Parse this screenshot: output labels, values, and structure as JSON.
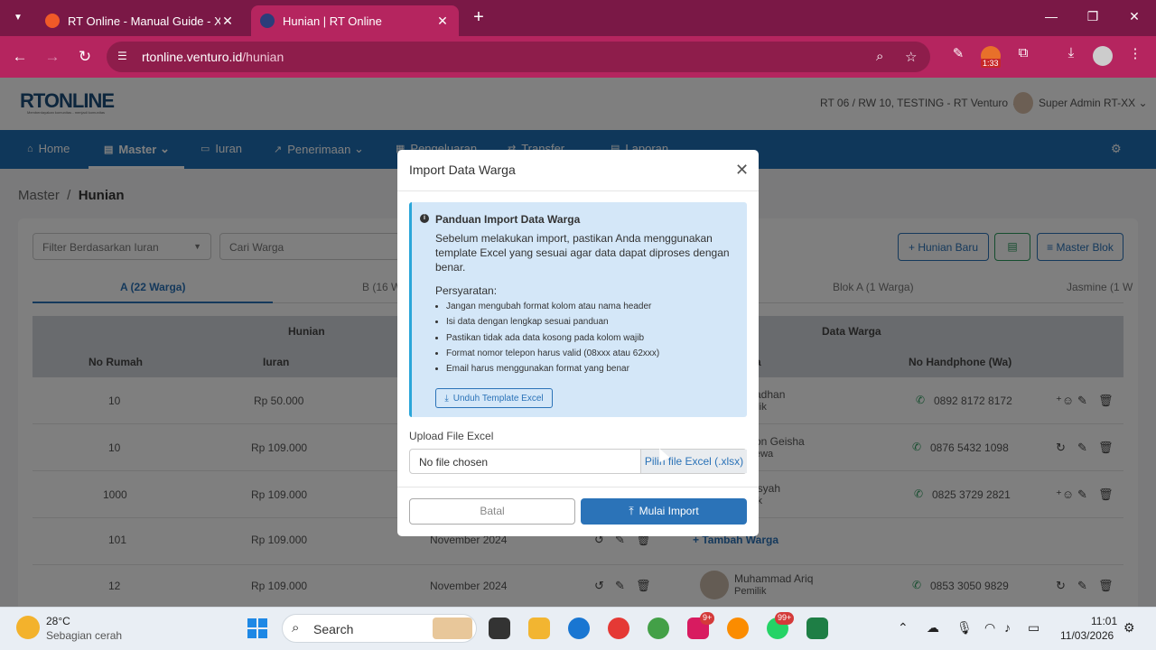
{
  "browser": {
    "tabs": [
      {
        "title": "RT Online - Manual Guide - Xm",
        "active": false
      },
      {
        "title": "Hunian | RT Online",
        "active": true
      }
    ],
    "url_host": "rtonline.venturo.id",
    "url_path": "/hunian",
    "ext_badge": "1:33"
  },
  "app": {
    "logo": "RTONLINE",
    "logo_sub": "Memberdayakan komunitas - menjadi komunitas",
    "rt_selector": "RT 06 / RW 10, TESTING - RT Venturo",
    "user_name": "Super Admin RT-XX",
    "nav": [
      {
        "label": "Home"
      },
      {
        "label": "Master"
      },
      {
        "label": "Iuran"
      },
      {
        "label": "Penerimaan"
      },
      {
        "label": "Pengeluaran"
      },
      {
        "label": "Transfer"
      },
      {
        "label": "Laporan"
      }
    ],
    "breadcrumb_parent": "Master",
    "breadcrumb_current": "Hunian",
    "filter_placeholder": "Filter Berdasarkan Iuran",
    "search_placeholder": "Cari Warga",
    "btn_hunian_baru": "Hunian Baru",
    "btn_master_blok": "Master Blok",
    "blok_tabs": [
      "A (22 Warga)",
      "B (16 W",
      "Blok A (1 Warga)",
      "Jasmine (1 W"
    ],
    "table": {
      "group_hunian": "Hunian",
      "group_warga": "Data Warga",
      "col_no_rumah": "No Rumah",
      "col_iuran": "Iuran",
      "col_nama_partial": "a",
      "col_hp": "No Handphone (Wa)",
      "rows": [
        {
          "no": "10",
          "iuran": "Rp 50.000",
          "periode": "",
          "nama": "adhan",
          "status": "ilik",
          "hp": "0892 8172 8172"
        },
        {
          "no": "10",
          "iuran": "Rp 109.000",
          "periode": "",
          "nama": "on Geisha",
          "status": "ewa",
          "hp": "0876 5432 1098"
        },
        {
          "no": "1000",
          "iuran": "Rp 109.000",
          "periode": "",
          "nama": "isyah",
          "status": "ik",
          "hp": "0825 3729 2821"
        },
        {
          "no": "101",
          "iuran": "Rp 109.000",
          "periode": "November 2024",
          "nama": "",
          "status": "",
          "hp": ""
        },
        {
          "no": "12",
          "iuran": "Rp 109.000",
          "periode": "November 2024",
          "nama": "Muhammad Ariq",
          "status": "Pemilik",
          "hp": "0853 3050 9829"
        }
      ],
      "tambah_warga": "+ Tambah Warga"
    }
  },
  "modal": {
    "title": "Import Data Warga",
    "guide_title": "Panduan Import Data Warga",
    "guide_desc": "Sebelum melakukan import, pastikan Anda menggunakan template Excel yang sesuai agar data dapat diproses dengan benar.",
    "req_title": "Persyaratan:",
    "requirements": [
      "Jangan mengubah format kolom atau nama header",
      "Isi data dengan lengkap sesuai panduan",
      "Pastikan tidak ada data kosong pada kolom wajib",
      "Format nomor telepon harus valid (08xxx atau 62xxx)",
      "Email harus menggunakan format yang benar"
    ],
    "btn_template": "Unduh Template Excel",
    "upload_label": "Upload File Excel",
    "file_status": "No file chosen",
    "file_button": "Pilih file Excel (.xlsx)",
    "btn_batal": "Batal",
    "btn_import": "Mulai Import"
  },
  "taskbar": {
    "temp": "28°C",
    "weather": "Sebagian cerah",
    "search": "Search",
    "badge_discord": "9+",
    "badge_whatsapp": "99+",
    "time": "11:01",
    "date": "11/03/2026"
  },
  "colors": {
    "browser_frame": "#b5255f",
    "nav_blue": "#1f6fb4",
    "primary": "#2b73b8",
    "guide_bg": "#d4e7f8",
    "whatsapp": "#2a9a5c"
  }
}
